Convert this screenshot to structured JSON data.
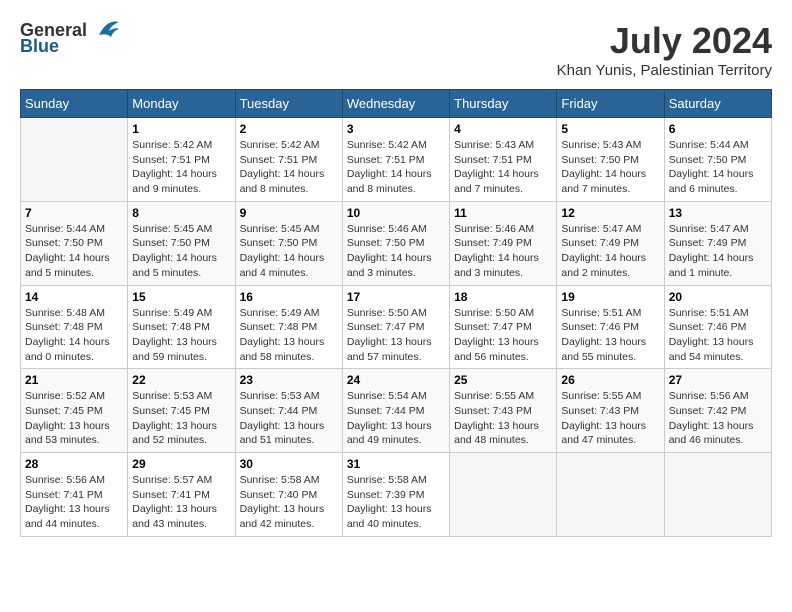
{
  "header": {
    "logo_general": "General",
    "logo_blue": "Blue",
    "month_year": "July 2024",
    "location": "Khan Yunis, Palestinian Territory"
  },
  "days_of_week": [
    "Sunday",
    "Monday",
    "Tuesday",
    "Wednesday",
    "Thursday",
    "Friday",
    "Saturday"
  ],
  "weeks": [
    [
      {
        "day": "",
        "info": ""
      },
      {
        "day": "1",
        "info": "Sunrise: 5:42 AM\nSunset: 7:51 PM\nDaylight: 14 hours\nand 9 minutes."
      },
      {
        "day": "2",
        "info": "Sunrise: 5:42 AM\nSunset: 7:51 PM\nDaylight: 14 hours\nand 8 minutes."
      },
      {
        "day": "3",
        "info": "Sunrise: 5:42 AM\nSunset: 7:51 PM\nDaylight: 14 hours\nand 8 minutes."
      },
      {
        "day": "4",
        "info": "Sunrise: 5:43 AM\nSunset: 7:51 PM\nDaylight: 14 hours\nand 7 minutes."
      },
      {
        "day": "5",
        "info": "Sunrise: 5:43 AM\nSunset: 7:50 PM\nDaylight: 14 hours\nand 7 minutes."
      },
      {
        "day": "6",
        "info": "Sunrise: 5:44 AM\nSunset: 7:50 PM\nDaylight: 14 hours\nand 6 minutes."
      }
    ],
    [
      {
        "day": "7",
        "info": "Sunrise: 5:44 AM\nSunset: 7:50 PM\nDaylight: 14 hours\nand 5 minutes."
      },
      {
        "day": "8",
        "info": "Sunrise: 5:45 AM\nSunset: 7:50 PM\nDaylight: 14 hours\nand 5 minutes."
      },
      {
        "day": "9",
        "info": "Sunrise: 5:45 AM\nSunset: 7:50 PM\nDaylight: 14 hours\nand 4 minutes."
      },
      {
        "day": "10",
        "info": "Sunrise: 5:46 AM\nSunset: 7:50 PM\nDaylight: 14 hours\nand 3 minutes."
      },
      {
        "day": "11",
        "info": "Sunrise: 5:46 AM\nSunset: 7:49 PM\nDaylight: 14 hours\nand 3 minutes."
      },
      {
        "day": "12",
        "info": "Sunrise: 5:47 AM\nSunset: 7:49 PM\nDaylight: 14 hours\nand 2 minutes."
      },
      {
        "day": "13",
        "info": "Sunrise: 5:47 AM\nSunset: 7:49 PM\nDaylight: 14 hours\nand 1 minute."
      }
    ],
    [
      {
        "day": "14",
        "info": "Sunrise: 5:48 AM\nSunset: 7:48 PM\nDaylight: 14 hours\nand 0 minutes."
      },
      {
        "day": "15",
        "info": "Sunrise: 5:49 AM\nSunset: 7:48 PM\nDaylight: 13 hours\nand 59 minutes."
      },
      {
        "day": "16",
        "info": "Sunrise: 5:49 AM\nSunset: 7:48 PM\nDaylight: 13 hours\nand 58 minutes."
      },
      {
        "day": "17",
        "info": "Sunrise: 5:50 AM\nSunset: 7:47 PM\nDaylight: 13 hours\nand 57 minutes."
      },
      {
        "day": "18",
        "info": "Sunrise: 5:50 AM\nSunset: 7:47 PM\nDaylight: 13 hours\nand 56 minutes."
      },
      {
        "day": "19",
        "info": "Sunrise: 5:51 AM\nSunset: 7:46 PM\nDaylight: 13 hours\nand 55 minutes."
      },
      {
        "day": "20",
        "info": "Sunrise: 5:51 AM\nSunset: 7:46 PM\nDaylight: 13 hours\nand 54 minutes."
      }
    ],
    [
      {
        "day": "21",
        "info": "Sunrise: 5:52 AM\nSunset: 7:45 PM\nDaylight: 13 hours\nand 53 minutes."
      },
      {
        "day": "22",
        "info": "Sunrise: 5:53 AM\nSunset: 7:45 PM\nDaylight: 13 hours\nand 52 minutes."
      },
      {
        "day": "23",
        "info": "Sunrise: 5:53 AM\nSunset: 7:44 PM\nDaylight: 13 hours\nand 51 minutes."
      },
      {
        "day": "24",
        "info": "Sunrise: 5:54 AM\nSunset: 7:44 PM\nDaylight: 13 hours\nand 49 minutes."
      },
      {
        "day": "25",
        "info": "Sunrise: 5:55 AM\nSunset: 7:43 PM\nDaylight: 13 hours\nand 48 minutes."
      },
      {
        "day": "26",
        "info": "Sunrise: 5:55 AM\nSunset: 7:43 PM\nDaylight: 13 hours\nand 47 minutes."
      },
      {
        "day": "27",
        "info": "Sunrise: 5:56 AM\nSunset: 7:42 PM\nDaylight: 13 hours\nand 46 minutes."
      }
    ],
    [
      {
        "day": "28",
        "info": "Sunrise: 5:56 AM\nSunset: 7:41 PM\nDaylight: 13 hours\nand 44 minutes."
      },
      {
        "day": "29",
        "info": "Sunrise: 5:57 AM\nSunset: 7:41 PM\nDaylight: 13 hours\nand 43 minutes."
      },
      {
        "day": "30",
        "info": "Sunrise: 5:58 AM\nSunset: 7:40 PM\nDaylight: 13 hours\nand 42 minutes."
      },
      {
        "day": "31",
        "info": "Sunrise: 5:58 AM\nSunset: 7:39 PM\nDaylight: 13 hours\nand 40 minutes."
      },
      {
        "day": "",
        "info": ""
      },
      {
        "day": "",
        "info": ""
      },
      {
        "day": "",
        "info": ""
      }
    ]
  ]
}
